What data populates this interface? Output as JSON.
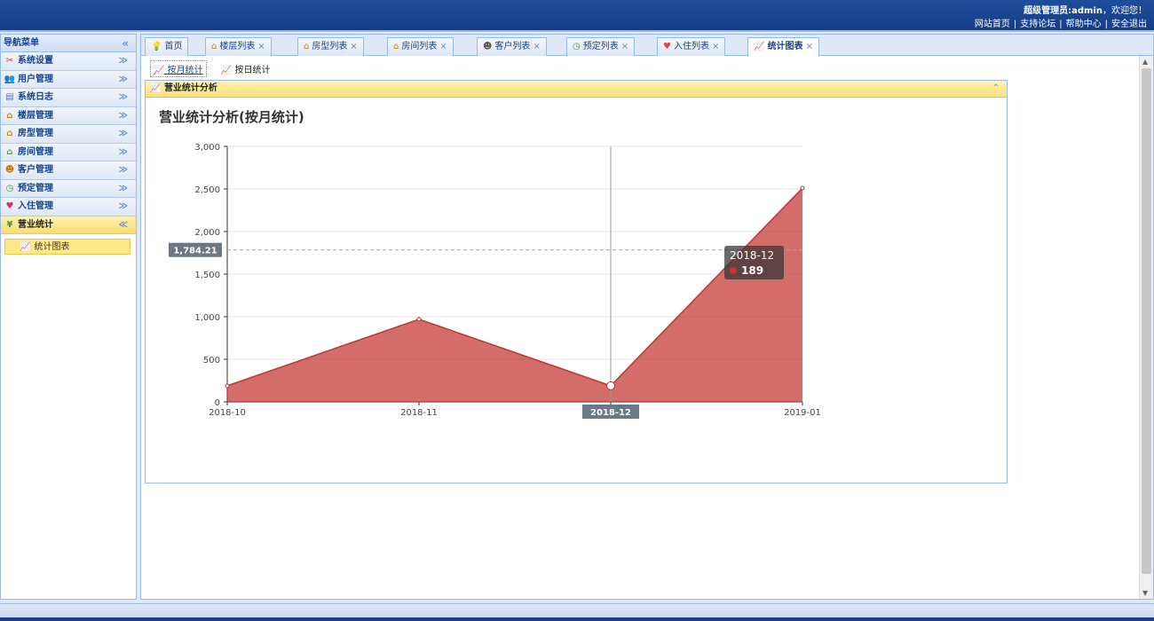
{
  "header": {
    "welcome_user": "超级管理员:admin",
    "welcome_suffix": "，欢迎您！",
    "links": [
      "网站首页",
      "支持论坛",
      "帮助中心",
      "安全退出"
    ]
  },
  "sidebar": {
    "title": "导航菜单",
    "items": [
      {
        "label": "系统设置",
        "icon": "tools-icon"
      },
      {
        "label": "用户管理",
        "icon": "users-icon"
      },
      {
        "label": "系统日志",
        "icon": "log-icon"
      },
      {
        "label": "楼层管理",
        "icon": "building-icon"
      },
      {
        "label": "房型管理",
        "icon": "house-icon"
      },
      {
        "label": "房间管理",
        "icon": "room-icon"
      },
      {
        "label": "客户管理",
        "icon": "customers-icon"
      },
      {
        "label": "预定管理",
        "icon": "clock-icon"
      },
      {
        "label": "入住管理",
        "icon": "checkin-icon"
      },
      {
        "label": "营业统计",
        "icon": "yen-icon"
      }
    ],
    "sub_item": "统计图表"
  },
  "tabs": [
    {
      "label": "首页",
      "closable": false
    },
    {
      "label": "楼层列表",
      "closable": true
    },
    {
      "label": "房型列表",
      "closable": true
    },
    {
      "label": "房间列表",
      "closable": true
    },
    {
      "label": "客户列表",
      "closable": true
    },
    {
      "label": "预定列表",
      "closable": true
    },
    {
      "label": "入住列表",
      "closable": true
    },
    {
      "label": "统计图表",
      "closable": true,
      "active": true
    }
  ],
  "subtoolbar": {
    "monthly": "按月统计",
    "daily": "按日统计"
  },
  "panel": {
    "title": "营业统计分析"
  },
  "chart_data": {
    "type": "area",
    "title": "营业统计分析(按月统计)",
    "categories": [
      "2018-10",
      "2018-11",
      "2018-12",
      "2019-01"
    ],
    "series": [
      {
        "values": [
          189,
          970,
          189,
          2510
        ],
        "color": "#c23531"
      }
    ],
    "ylim": [
      0,
      3000
    ],
    "yticks": [
      "0",
      "500",
      "1,000",
      "1,500",
      "2,000",
      "2,500",
      "3,000"
    ],
    "tooltip": {
      "category": "2018-12",
      "value": "189"
    },
    "crosshair": {
      "y_label": "1,784.21",
      "x_label": "2018-12"
    },
    "grid": true
  }
}
